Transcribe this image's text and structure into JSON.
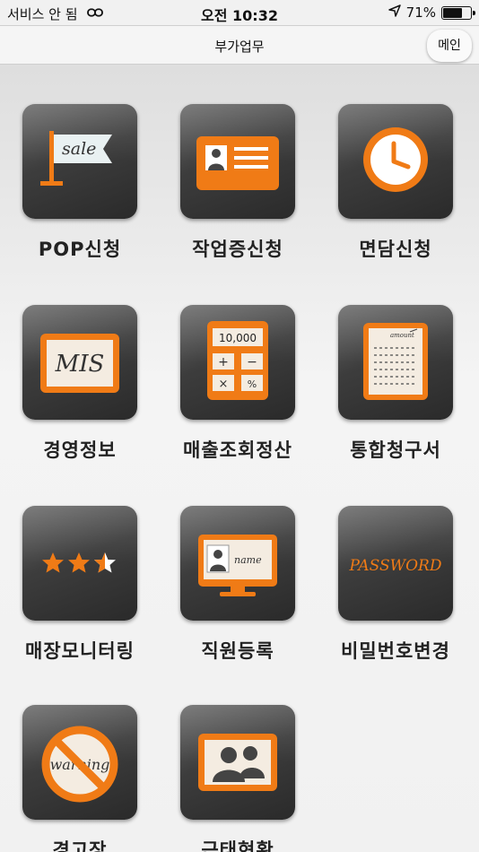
{
  "status_bar": {
    "carrier": "서비스 안 됨",
    "time": "오전 10:32",
    "battery_percent": "71%",
    "battery_level": 0.71
  },
  "nav": {
    "title": "부가업무",
    "main_button": "메인"
  },
  "icon_texts": {
    "sale": "sale",
    "mis": "MIS",
    "calculator_display": "10,000",
    "name": "name",
    "password": "PASSWORD",
    "warning": "warning",
    "receipt": "amount"
  },
  "tiles": [
    {
      "label": "POP신청",
      "icon": "sale-flag-icon"
    },
    {
      "label": "작업증신청",
      "icon": "id-card-icon"
    },
    {
      "label": "면담신청",
      "icon": "clock-icon"
    },
    {
      "label": "경영정보",
      "icon": "mis-board-icon"
    },
    {
      "label": "매출조회정산",
      "icon": "calculator-icon"
    },
    {
      "label": "통합청구서",
      "icon": "receipt-icon"
    },
    {
      "label": "매장모니터링",
      "icon": "star-rating-icon"
    },
    {
      "label": "직원등록",
      "icon": "monitor-name-icon"
    },
    {
      "label": "비밀번호변경",
      "icon": "password-icon"
    },
    {
      "label": "경고장",
      "icon": "no-warning-icon"
    },
    {
      "label": "근태현황",
      "icon": "people-icon"
    }
  ],
  "colors": {
    "accent": "#f07b16",
    "tile_dark": "#3a3a3a",
    "background": "#f1f1f1"
  }
}
